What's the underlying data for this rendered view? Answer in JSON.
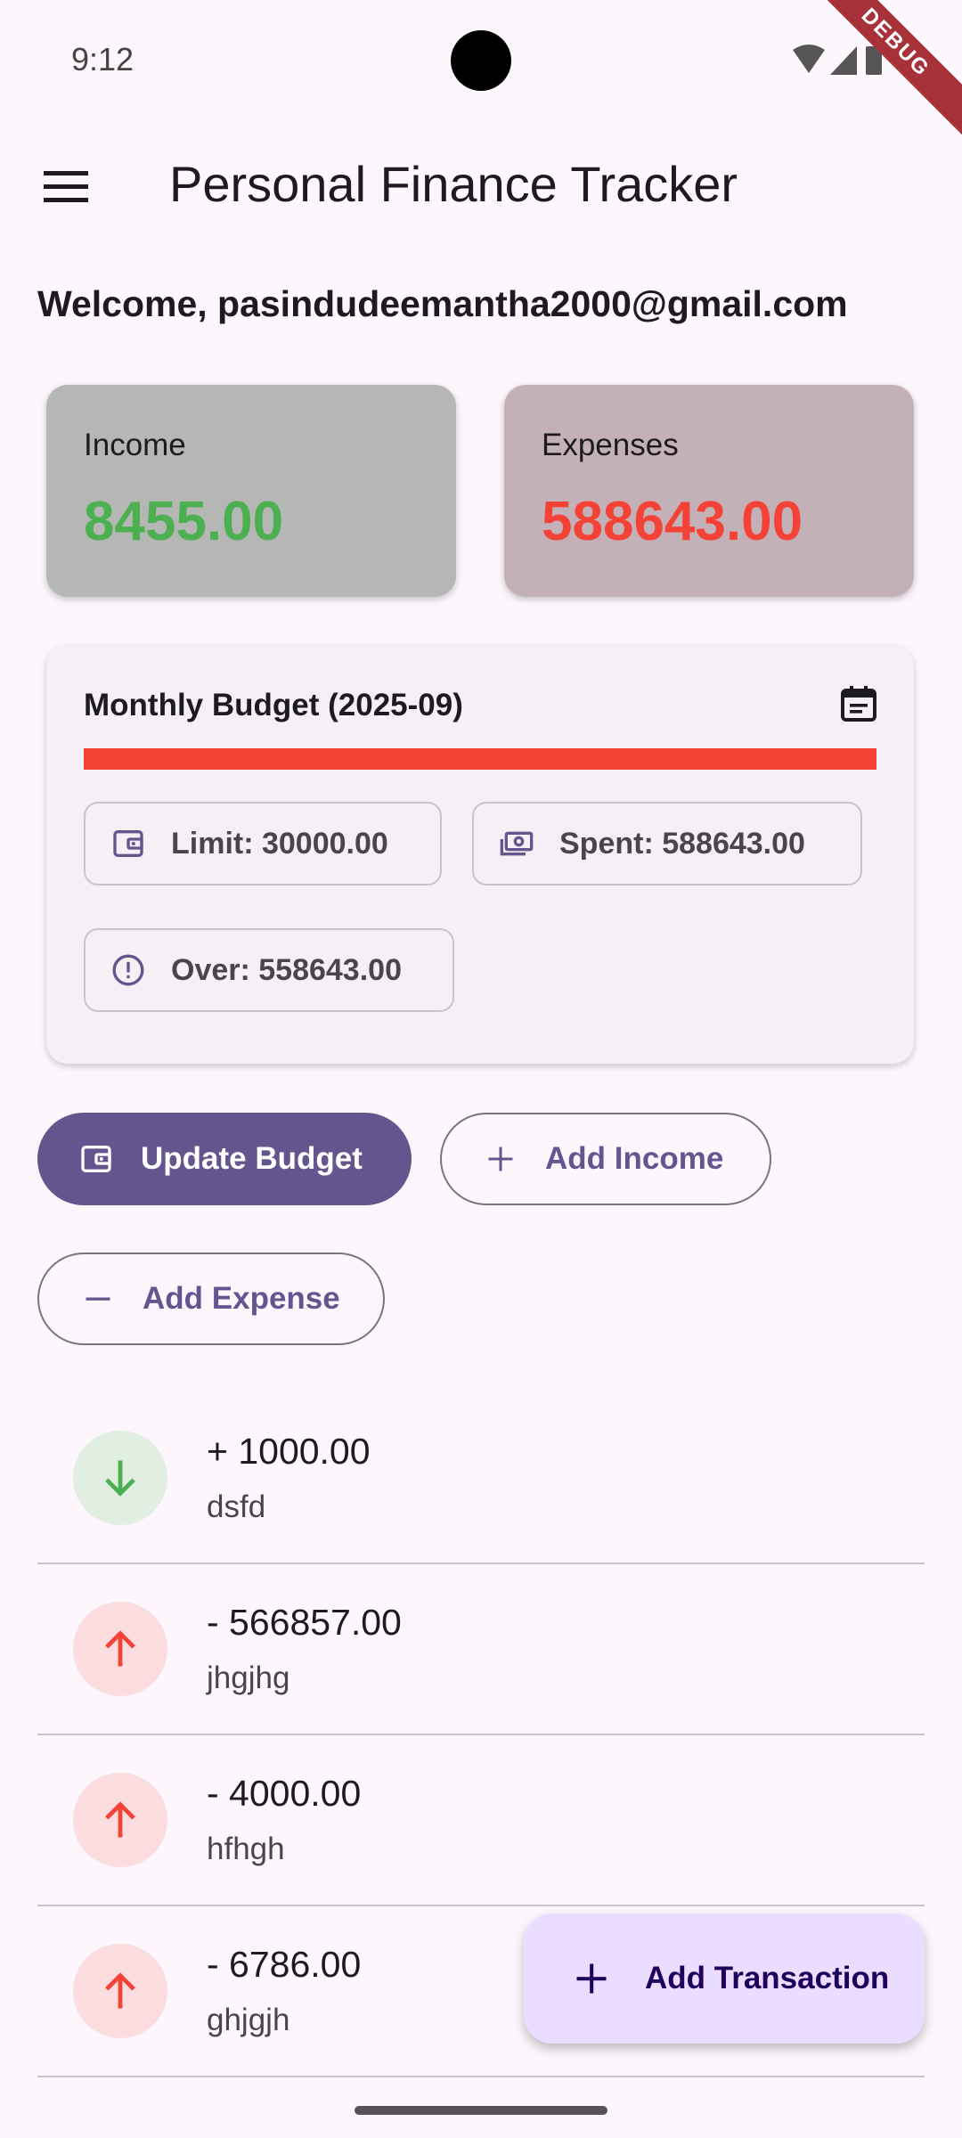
{
  "status_bar": {
    "time": "9:12",
    "debug_label": "DEBUG"
  },
  "app_bar": {
    "title": "Personal Finance Tracker",
    "menu_icon": "menu-icon"
  },
  "welcome": "Welcome, pasindudeemantha2000@gmail.com",
  "summary": {
    "income": {
      "label": "Income",
      "value": "8455.00",
      "color": "#4caf50"
    },
    "expenses": {
      "label": "Expenses",
      "value": "588643.00",
      "color": "#f44336"
    }
  },
  "budget": {
    "title": "Monthly Budget (2025-09)",
    "progress_fraction": 1.0,
    "limit_label": "Limit: 30000.00",
    "spent_label": "Spent: 588643.00",
    "over_label": "Over: 558643.00",
    "icons": {
      "calendar": "calendar-icon",
      "limit": "wallet-icon",
      "spent": "cash-icon",
      "over": "alert-circle-icon"
    }
  },
  "actions": {
    "update_budget": "Update Budget",
    "add_income": "Add Income",
    "add_expense": "Add Expense"
  },
  "transactions": [
    {
      "amount": "+ 1000.00",
      "description": "dsfd",
      "type": "income",
      "icon": "arrow-down-icon"
    },
    {
      "amount": "- 566857.00",
      "description": "jhgjhg",
      "type": "expense",
      "icon": "arrow-up-icon"
    },
    {
      "amount": "- 4000.00",
      "description": "hfhgh",
      "type": "expense",
      "icon": "arrow-up-icon"
    },
    {
      "amount": "- 6786.00",
      "description": "ghjgjh",
      "type": "expense",
      "icon": "arrow-up-icon"
    }
  ],
  "fab": {
    "label": "Add Transaction",
    "icon": "plus-icon"
  },
  "colors": {
    "primary": "#65558f",
    "background": "#fdf7fd",
    "fab": "#eaddff",
    "income": "#4caf50",
    "expense": "#f44336"
  }
}
